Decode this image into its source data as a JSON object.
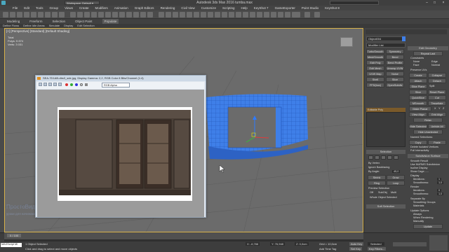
{
  "window": {
    "title": "Autodesk 3ds Max 2016   tumba.max"
  },
  "menu": [
    "File",
    "Edit",
    "Tools",
    "Group",
    "Views",
    "Create",
    "Modifiers",
    "Animation",
    "Graph Editors",
    "Rendering",
    "Civil View",
    "Customize",
    "Scripting",
    "Help",
    "KeyShot 7",
    "GameExporter",
    "Point Studio",
    "KeyShot 8"
  ],
  "ribbon_tabs": [
    "Modeling",
    "Freeform",
    "Selection",
    "Object Paint",
    "Populate"
  ],
  "ribbon_tab_active": "Populate",
  "ribbon_sub": [
    "Define Flows",
    "Define Idle Areas",
    "Simulate",
    "Display",
    "Edit Selection"
  ],
  "viewport": {
    "label": "[+] [Perspective] [Standard] [Default Shading]",
    "stats": [
      "Total",
      "Polys: 5 874",
      "Verts: 3 031"
    ],
    "watermark": "ПростоВидео.ru",
    "watermark_sub": "уроки для начинающих"
  },
  "command_panel": {
    "object_name": "Object004",
    "modifier_list": "Modifier List",
    "modifier_buttons": [
      "TurboSmooth",
      "Symmetry",
      "MeshSmooth",
      "Bend",
      "Edit Poly",
      "Bend Profile",
      "Edit Mesh",
      "Unwrap UVW",
      "UVW Map",
      "Noise",
      "Shell",
      "Slice",
      "FFD(box)",
      "OpenSubdiv"
    ],
    "stack_item": "Editable Poly",
    "edit_geometry": {
      "title": "Edit Geometry",
      "repeat_last": "Repeat Last",
      "constraints": "Constraints",
      "c_none": "None",
      "c_edge": "Edge",
      "c_face": "Face",
      "c_normal": "Normal",
      "preserve_uvs": "Preserve UVs",
      "create": "Create",
      "collapse": "Collapse",
      "attach": "Attach",
      "detach": "Detach",
      "slice_plane": "Slice Plane",
      "split": "Split",
      "slice": "Slice",
      "reset_plane": "Reset Plane",
      "quickslice": "QuickSlice",
      "cut": "Cut",
      "msmooth": "MSmooth",
      "tessellate": "Tessellate",
      "make_planar": "Make Planar",
      "x": "X",
      "y": "Y",
      "z": "Z",
      "view_align": "View Align",
      "grid_align": "Grid Align",
      "relax": "Relax",
      "hide_selected": "Hide Selected",
      "unhide_all": "Unhide All",
      "hide_unselected": "Hide Unselected",
      "named_selections": "Named Selections:",
      "copy": "Copy",
      "paste": "Paste",
      "delete_isolated": "Delete Isolated Vertices",
      "full_interactivity": "Full Interactivity"
    },
    "selection": {
      "title": "Selection",
      "by_vertex": "By Vertex",
      "ignore_backfacing": "Ignore Backfacing",
      "by_angle": "By Angle:",
      "angle_value": "45,0",
      "shrink": "Shrink",
      "grow": "Grow",
      "ring": "Ring",
      "loop": "Loop",
      "preview_selection": "Preview Selection",
      "off": "Off",
      "subobj": "SubObj",
      "multi": "Multi",
      "whole_selected": "Whole Object Selected"
    },
    "soft_selection": {
      "title": "Soft Selection"
    },
    "subdivision": {
      "title": "Subdivision Surface",
      "smooth_result": "Smooth Result",
      "use_nurms": "Use NURMS Subdivision",
      "isoline_display": "Isoline Display",
      "show_cage": "Show Cage......",
      "display": "Display",
      "iterations_label": "Iterations:",
      "iterations": "1",
      "smoothness_label": "Smoothness:",
      "smoothness": "1,0",
      "render": "Render",
      "r_iterations": "Iterations:",
      "r_iterations_val": "0",
      "r_smoothness": "Smoothness:",
      "r_smoothness_val": "1,0",
      "separate_by": "Separate By",
      "smoothing_groups": "Smoothing Groups",
      "materials": "Materials",
      "update_options": "Update Options",
      "always": "Always",
      "when_rendering": "When Rendering",
      "manually": "Manually",
      "update": "Update"
    }
  },
  "render_window": {
    "title": "SEA-7D1AB-dbs3_sde.jpg, Display Gamma: 2,2, RGB Color 8 Bits/Channel (1:4)",
    "channel": "RGB Alpha"
  },
  "status": {
    "selected": "1 Object Selected",
    "prompt": "Click and drag to select and move objects",
    "script": "MAXScript Mi",
    "coord_x": "X: -6,766",
    "coord_y": "Y: 76,948",
    "coord_z": "Z: 0,0cm",
    "grid": "Grid = 10,0cm",
    "auto_key": "Auto Key",
    "selected_key": "Selected",
    "set_key": "Set Key",
    "key_filters": "Key Filters...",
    "add_time_tag": "Add Time Tag",
    "frame": "0 / 100"
  },
  "colors": {
    "object_blue": "#3f7fe8",
    "wire": "#1f4fb0",
    "viewport_bg": "#6b6b6b",
    "accent": "#d8b24a"
  }
}
